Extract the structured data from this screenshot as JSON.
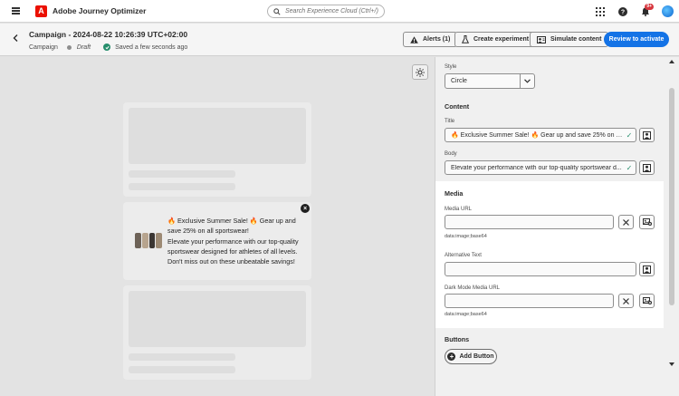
{
  "app": {
    "name": "Adobe Journey Optimizer"
  },
  "search": {
    "placeholder": "Search Experience Cloud (Ctrl+/)"
  },
  "notifications": {
    "badge": "9+"
  },
  "header": {
    "title": "Campaign - 2024-08-22 10:26:39 UTC+02:00",
    "type": "Campaign",
    "status": "Draft",
    "saved": "Saved a few seconds ago",
    "alerts_label": "Alerts (1)",
    "experiment_label": "Create experiment",
    "simulate_label": "Simulate content",
    "review_label": "Review to activate"
  },
  "preview": {
    "title": "🔥 Exclusive Summer Sale! 🔥 Gear up and save 25% on all sportswear!",
    "body": "Elevate your performance with our top-quality sportswear designed for athletes of all levels. Don't miss out on these unbeatable savings!"
  },
  "panel": {
    "style_label": "Style",
    "style_value": "Circle",
    "content_heading": "Content",
    "title_label": "Title",
    "title_value": "🔥 Exclusive Summer Sale! 🔥 Gear up and save 25% on all s...",
    "body_label": "Body",
    "body_value": "Elevate your performance with our top-quality sportswear d...",
    "media_heading": "Media",
    "media_url_label": "Media URL",
    "media_url_value": "",
    "media_url_hint": "data:image;base64",
    "alt_text_label": "Alternative Text",
    "alt_text_value": "",
    "dark_url_label": "Dark Mode Media URL",
    "dark_url_value": "",
    "dark_url_hint": "data:image;base64",
    "buttons_heading": "Buttons",
    "add_button_label": "Add Button"
  },
  "colors": {
    "accent": "#1473e6",
    "brand": "#eb1000",
    "success": "#268e6c",
    "fire": "#f07b18"
  }
}
